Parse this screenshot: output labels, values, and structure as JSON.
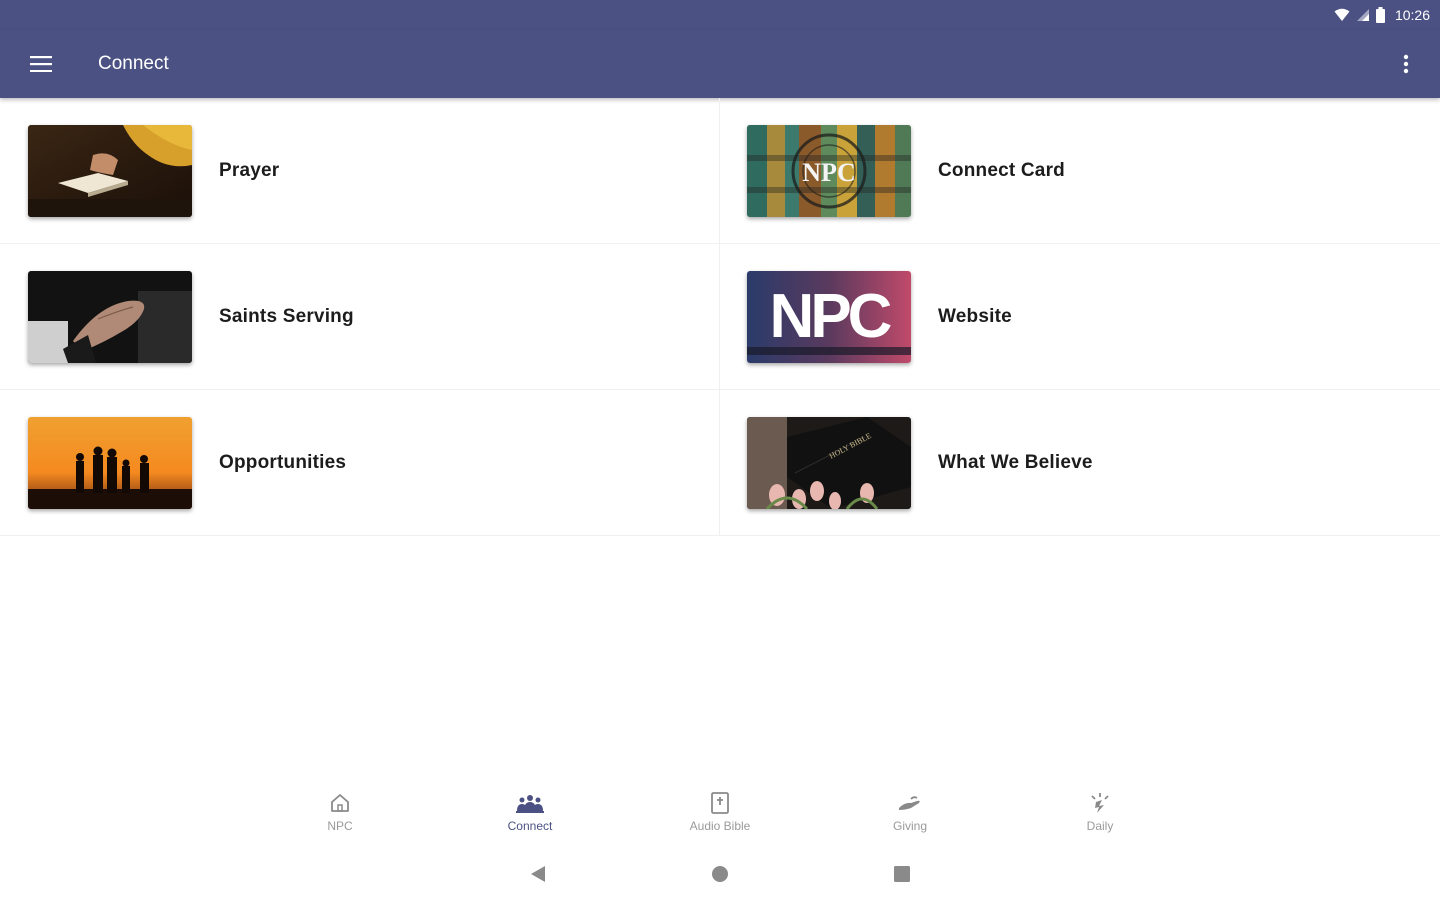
{
  "status_bar": {
    "time": "10:26",
    "wifi_icon": "wifi-icon",
    "signal_icon": "signal-icon",
    "battery_icon": "battery-icon"
  },
  "app_bar": {
    "title": "Connect",
    "menu_icon": "hamburger-menu-icon",
    "overflow_icon": "more-vertical-icon",
    "color": "#4b5183"
  },
  "items": [
    {
      "label": "Prayer",
      "thumb": "prayer-bible-photo"
    },
    {
      "label": "Connect Card",
      "thumb": "npc-logo-wood-photo"
    },
    {
      "label": "Saints Serving",
      "thumb": "open-hand-photo"
    },
    {
      "label": "Website",
      "thumb": "npc-logo-photo"
    },
    {
      "label": "Opportunities",
      "thumb": "sunset-family-photo"
    },
    {
      "label": "What We Believe",
      "thumb": "holy-bible-tulips-photo"
    }
  ],
  "bottom_nav": [
    {
      "label": "NPC",
      "icon": "home-icon",
      "active": false
    },
    {
      "label": "Connect",
      "icon": "group-icon",
      "active": true
    },
    {
      "label": "Audio Bible",
      "icon": "bible-icon",
      "active": false
    },
    {
      "label": "Giving",
      "icon": "giving-hand-icon",
      "active": false
    },
    {
      "label": "Daily",
      "icon": "daily-spark-icon",
      "active": false
    }
  ],
  "system_nav": {
    "back": "back-triangle-icon",
    "home": "home-circle-icon",
    "recents": "recents-square-icon"
  },
  "colors": {
    "primary": "#4b5183",
    "active_nav": "#4b5183",
    "inactive_nav": "#9a9a9a"
  }
}
